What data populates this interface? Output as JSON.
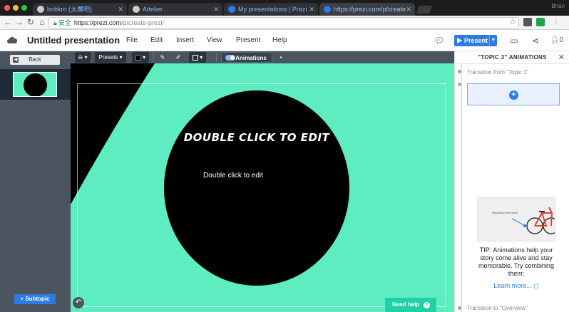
{
  "browser": {
    "tabs": [
      {
        "label": "bobkro (太魔吧)",
        "active": false
      },
      {
        "label": "Attelier",
        "active": false
      },
      {
        "label": "My presentations | Prezi",
        "active": false
      },
      {
        "label": "https://prezi.com/p/create",
        "active": true
      }
    ],
    "user": "Brian",
    "secure_label": "安全",
    "url_host": "https://prezi.com",
    "url_path": "/p/create-prezi/"
  },
  "app": {
    "title": "Untitled presentation",
    "menu": [
      "File",
      "Edit",
      "Insert",
      "View",
      "Present",
      "Help"
    ],
    "present_label": "Present",
    "viewers": "0"
  },
  "sidebar": {
    "back_label": "Back",
    "subtopic_label": "+ Subtopic"
  },
  "toolbar": {
    "presets_label": "Presets",
    "animations_label": "Animations"
  },
  "slide": {
    "title": "DOUBLE CLICK TO EDIT",
    "body": "Double click to edit"
  },
  "canvas": {
    "need_help_label": "Need help"
  },
  "panel": {
    "title": "\"TOPIC 3\" ANIMATIONS",
    "transition_from": "Transition from \"Topic 1\"",
    "transition_to": "Transition to \"Overview\"",
    "tip_image_text": "Reposition elements",
    "tip_text": "TIP: Animations help your story come alive and stay memorable. Try combining them:",
    "learn_more": "Learn more..."
  },
  "colors": {
    "canvas_bg": "#5eedc0",
    "accent": "#2f7be5",
    "sidebar_bg": "#4b5560",
    "help_button": "#1fd1a6"
  }
}
